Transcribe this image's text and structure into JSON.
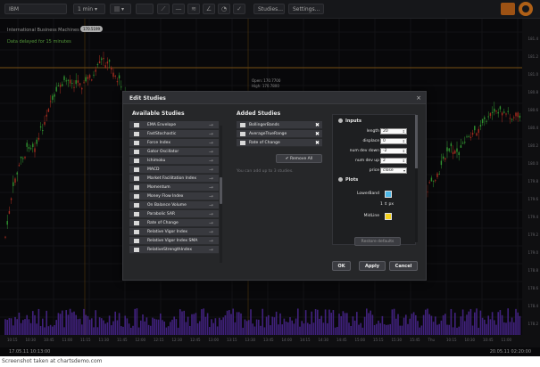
{
  "toolbar": {
    "symbol": "IBM",
    "interval": "1 min",
    "interval_arrow": "▾",
    "chart_type": "|||",
    "chart_type_arrow": "▾",
    "studies_label": "Studies...",
    "settings_label": "Settings..."
  },
  "chart": {
    "security_name": "International Business Machines",
    "delay_note": "Data delayed for 15 minutes",
    "last_badge": "170.5199",
    "tooltip": {
      "open": "Open: 170.7700",
      "high": "High: 170.7800"
    },
    "price_ticks": [
      "181.4",
      "181.2",
      "181.0",
      "180.8",
      "180.6",
      "180.4",
      "180.2",
      "180.0",
      "179.8",
      "179.6",
      "179.4",
      "179.2",
      "179.0",
      "178.8",
      "178.6",
      "178.4",
      "178.2"
    ],
    "time_ticks": [
      "10:15",
      "10:30",
      "10:45",
      "11:00",
      "11:15",
      "11:30",
      "11:45",
      "12:00",
      "12:15",
      "12:30",
      "12:45",
      "13:00",
      "13:15",
      "13:30",
      "13:45",
      "14:00",
      "14:15",
      "14:30",
      "14:45",
      "15:00",
      "15:15",
      "15:30",
      "15:45",
      "Thu",
      "10:15",
      "10:30",
      "10:45",
      "11:00"
    ],
    "range_start": "17.05.11 10:13:00",
    "range_end": "20.05.11 02:20:00"
  },
  "dialog": {
    "title": "Edit Studies",
    "close": "×",
    "available_title": "Available Studies",
    "added_title": "Added Studies",
    "available_studies": [
      "EMA Envelope",
      "FastStochastic",
      "Force Index",
      "Gator Oscillator",
      "Ichimoku",
      "MACD",
      "Market Facilitation Index",
      "Momentum",
      "Money Flow Index",
      "On Balance Volume",
      "Parabolic SAR",
      "Rate of Change",
      "Relative Vigor Index",
      "Relative Vigor Index SMA",
      "RelativeStrengthIndex"
    ],
    "added_studies": [
      "BollingerBands",
      "AverageTrueRange",
      "Rate of Change"
    ],
    "remove_all": "Remove All",
    "limit_note": "You can add up to 3 studies.",
    "inputs_label": "Inputs",
    "inputs": [
      {
        "label": "length",
        "value": "20"
      },
      {
        "label": "displace",
        "value": "0"
      },
      {
        "label": "num dev down",
        "value": "-2"
      },
      {
        "label": "num dev up",
        "value": "2"
      },
      {
        "label": "price",
        "value": "close"
      }
    ],
    "plots_label": "Plots",
    "plots": [
      {
        "label": "LowerBand",
        "color": "#4db8e8"
      },
      {
        "label": "MidLine",
        "color": "#f4d21e"
      }
    ],
    "px_value": "1",
    "px_unit": "px",
    "restore_label": "Restore defaults",
    "ok_label": "OK",
    "apply_label": "Apply",
    "cancel_label": "Cancel"
  },
  "caption": "Screenshot taken at chartsdemo.com"
}
